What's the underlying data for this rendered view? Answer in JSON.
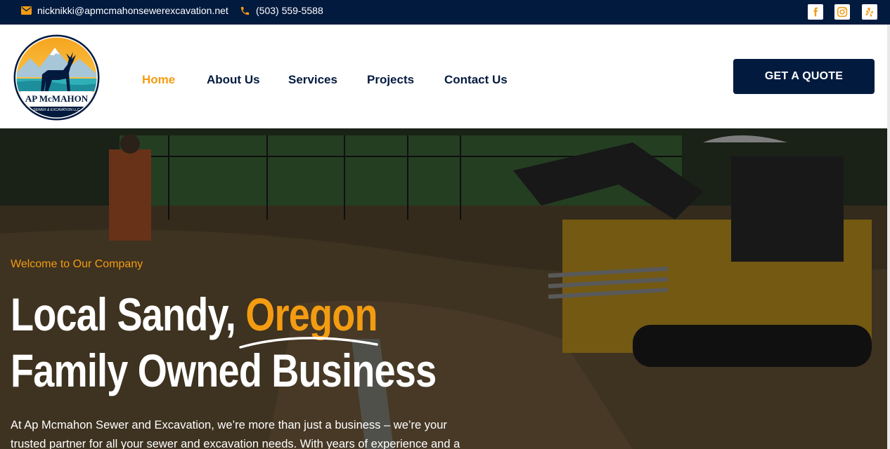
{
  "colors": {
    "navy": "#031a3f",
    "accent": "#f39c12",
    "white": "#ffffff"
  },
  "topbar": {
    "email": "nicknikki@apmcmahonsewerexcavation.net",
    "email_icon": "envelope-icon",
    "phone": "(503) 559-5588",
    "phone_icon": "phone-icon",
    "social": [
      "facebook-icon",
      "instagram-icon",
      "yelp-icon"
    ]
  },
  "logo": {
    "name": "AP McMAHON",
    "tagline": "SEWER & EXCAVATION LLC"
  },
  "nav": {
    "items": [
      {
        "label": "Home",
        "active": true
      },
      {
        "label": "About Us",
        "active": false
      },
      {
        "label": "Services",
        "active": false
      },
      {
        "label": "Projects",
        "active": false
      },
      {
        "label": "Contact Us",
        "active": false
      }
    ],
    "cta_label": "GET A QUOTE"
  },
  "hero": {
    "eyebrow": "Welcome to Our Company",
    "headline_part1": "Local Sandy, ",
    "headline_highlight": "Oregon",
    "headline_part2": " Family Owned Business",
    "body": "At Ap Mcmahon Sewer and Excavation, we’re more than just a business – we’re your trusted partner for all your sewer and excavation needs. With years of experience and a"
  }
}
